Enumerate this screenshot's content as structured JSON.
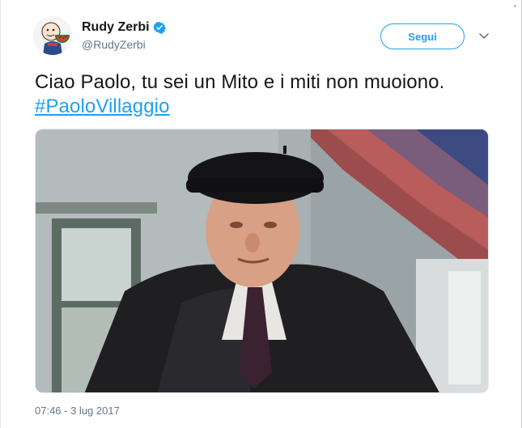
{
  "tweet": {
    "display_name": "Rudy Zerbi",
    "handle": "@RudyZerbi",
    "follow_label": "Segui",
    "text_before": "Ciao Paolo, tu sei un Mito e i miti non muoiono. ",
    "hashtag": "#PaoloVillaggio",
    "timestamp": "07:46 - 3 lug 2017"
  },
  "icons": {
    "verified": "verified-badge-icon",
    "more": "chevron-down-icon"
  },
  "colors": {
    "accent": "#1da1f2",
    "text": "#14171a",
    "muted": "#657786"
  }
}
